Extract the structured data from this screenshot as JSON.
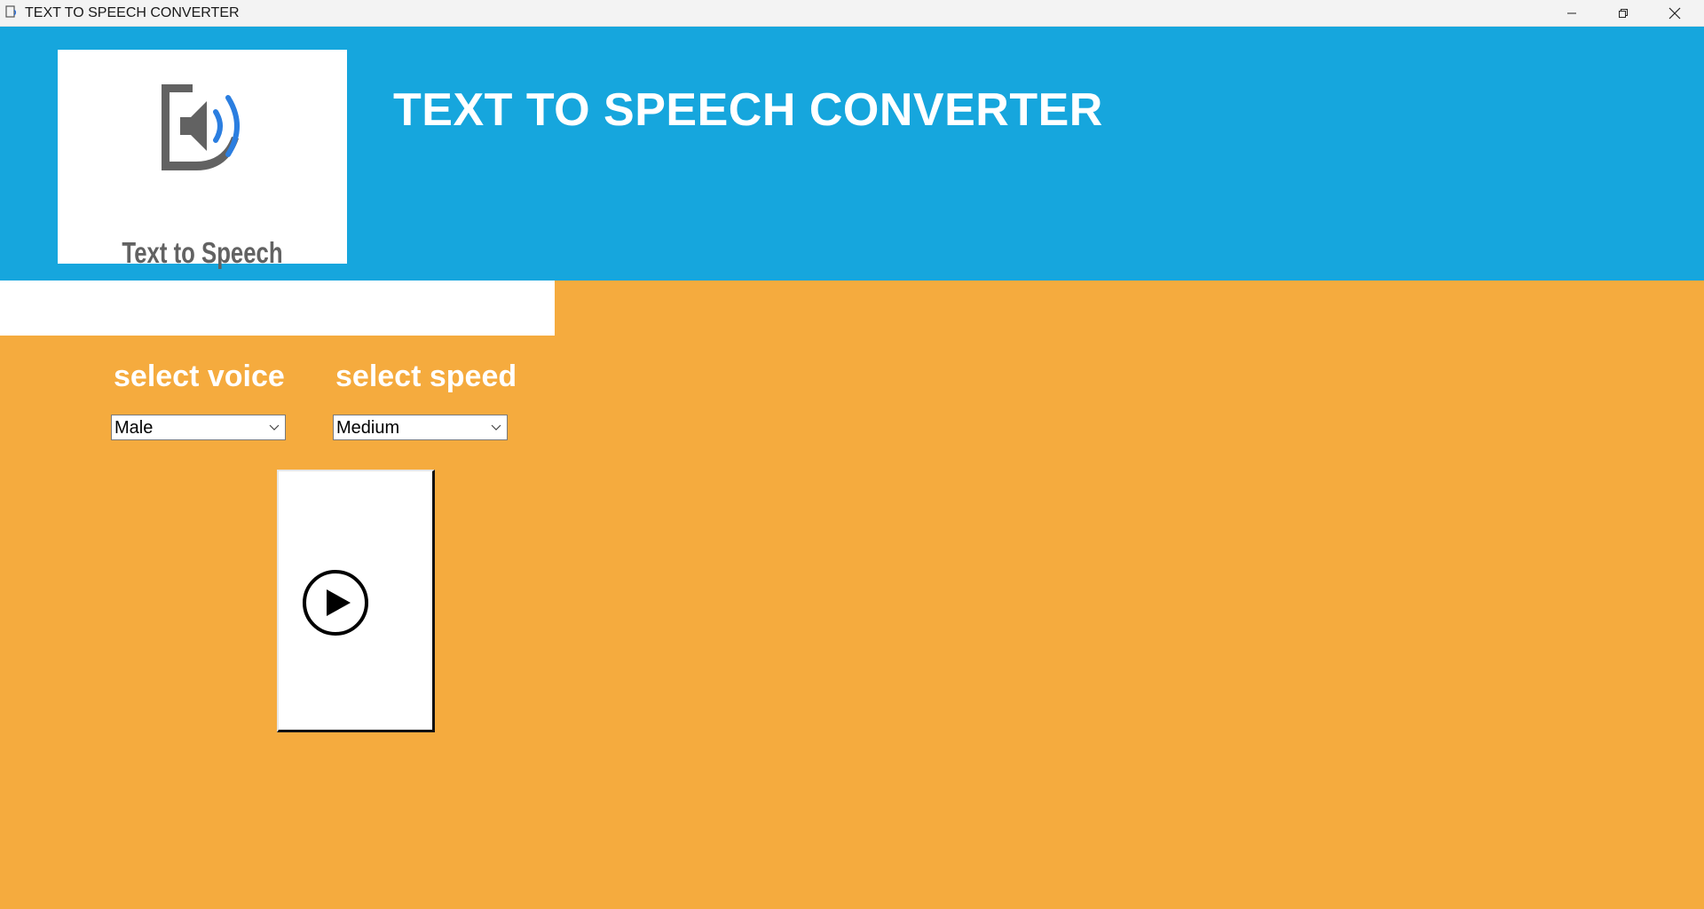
{
  "window": {
    "title": "TEXT TO SPEECH CONVERTER",
    "app_icon": "app-icon"
  },
  "header": {
    "title": "TEXT TO SPEECH CONVERTER",
    "logo_text": "Text to Speech",
    "logo_icon": "speaker-icon",
    "background": "#16a6dd"
  },
  "main": {
    "background": "#f5ab3e",
    "text_input": {
      "value": "",
      "placeholder": ""
    },
    "voice": {
      "label": "select voice",
      "selected": "Male"
    },
    "speed": {
      "label": "select speed",
      "selected": "Medium"
    },
    "play_button": {
      "icon": "play-icon"
    }
  }
}
